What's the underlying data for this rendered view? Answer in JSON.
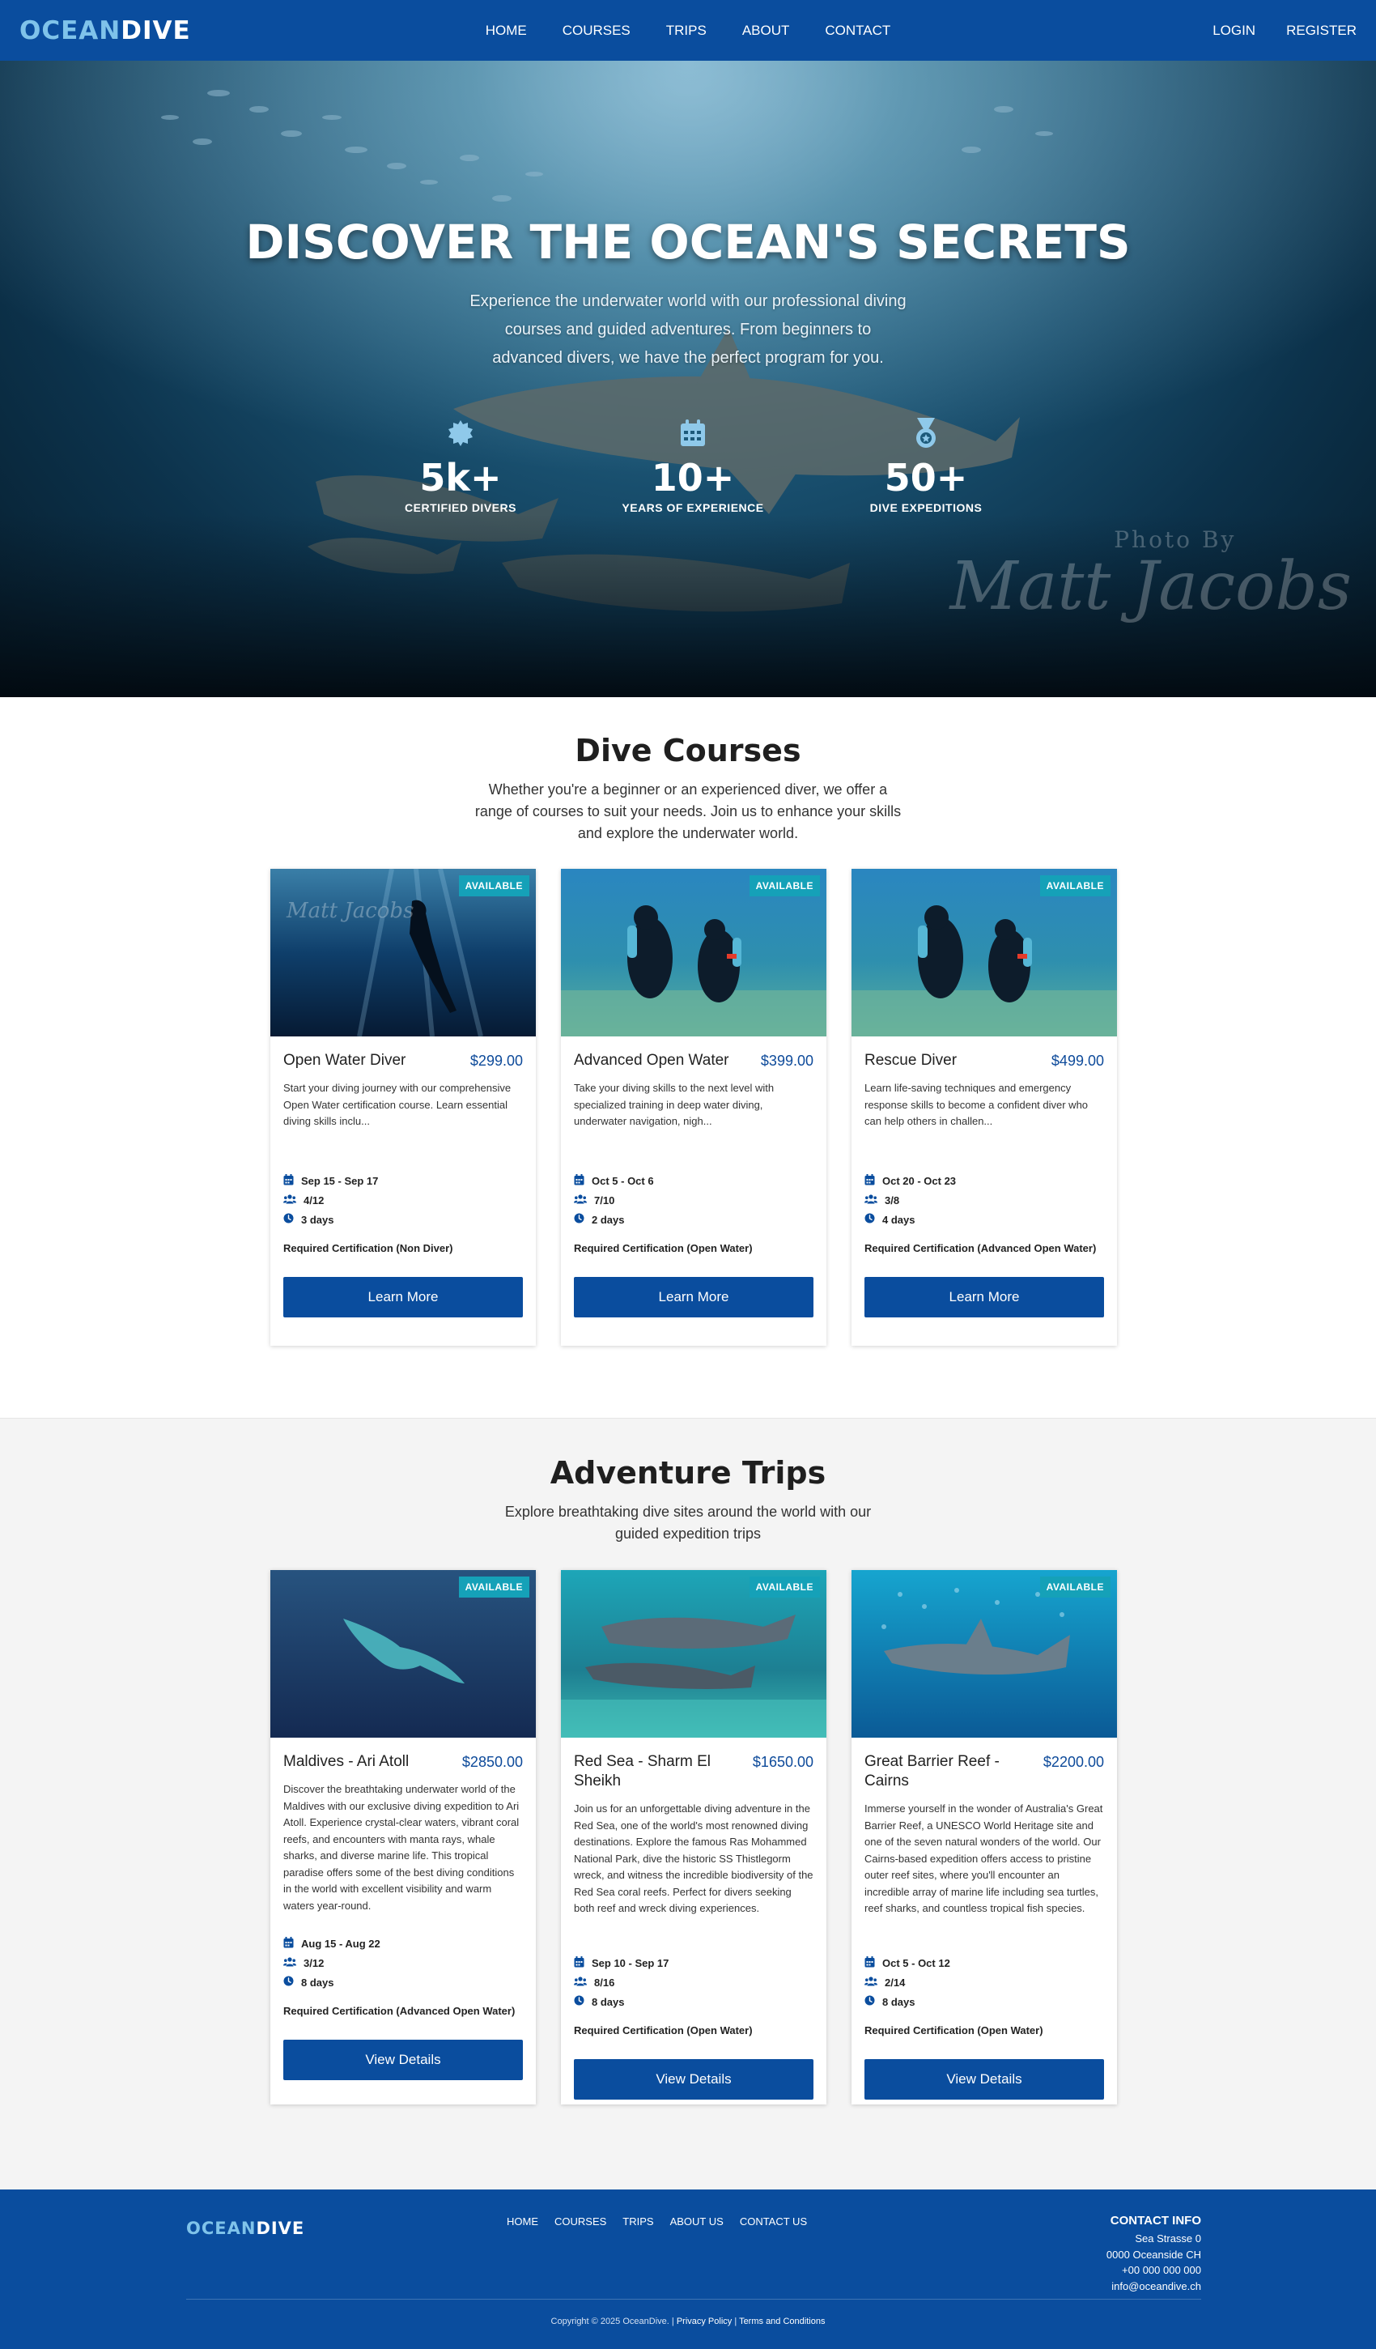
{
  "nav": {
    "logo_part1": "OCEAN",
    "logo_part2": "DIVE",
    "links": [
      "HOME",
      "COURSES",
      "TRIPS",
      "ABOUT",
      "CONTACT"
    ],
    "login": "LOGIN",
    "register": "REGISTER"
  },
  "hero": {
    "title": "DISCOVER THE OCEAN'S SECRETS",
    "subtitle": "Experience the underwater world with our professional diving courses and guided adventures. From beginners to advanced divers, we have the perfect program for you.",
    "stats": [
      {
        "value": "5k+",
        "label": "CERTIFIED DIVERS",
        "icon": "badge-icon"
      },
      {
        "value": "10+",
        "label": "YEARS OF EXPERIENCE",
        "icon": "calendar-icon"
      },
      {
        "value": "50+",
        "label": "DIVE EXPEDITIONS",
        "icon": "medal-icon"
      }
    ],
    "photo_credit_line1": "Photo By",
    "photo_credit_line2": "Matt Jacobs"
  },
  "courses": {
    "title": "Dive Courses",
    "subtitle": "Whether you're a beginner or an experienced diver, we offer a range of courses to suit your needs. Join us to enhance your skills and explore the underwater world.",
    "items": [
      {
        "badge": "AVAILABLE",
        "title": "Open Water Diver",
        "price": "$299.00",
        "desc": "Start your diving journey with our comprehensive Open Water certification course. Learn essential diving skills inclu...",
        "dates": "Sep 15 - Sep 17",
        "spots": "4/12",
        "duration": "3 days",
        "cert": "Required Certification (Non Diver)",
        "button": "Learn More"
      },
      {
        "badge": "AVAILABLE",
        "title": "Advanced Open Water",
        "price": "$399.00",
        "desc": "Take your diving skills to the next level with specialized training in deep water diving, underwater navigation, nigh...",
        "dates": "Oct 5 - Oct 6",
        "spots": "7/10",
        "duration": "2 days",
        "cert": "Required Certification (Open Water)",
        "button": "Learn More"
      },
      {
        "badge": "AVAILABLE",
        "title": "Rescue Diver",
        "price": "$499.00",
        "desc": "Learn life-saving techniques and emergency response skills to become a confident diver who can help others in challen...",
        "dates": "Oct 20 - Oct 23",
        "spots": "3/8",
        "duration": "4 days",
        "cert": "Required Certification (Advanced Open Water)",
        "button": "Learn More"
      }
    ]
  },
  "trips": {
    "title": "Adventure Trips",
    "subtitle": "Explore breathtaking dive sites around the world with our guided expedition trips",
    "items": [
      {
        "badge": "AVAILABLE",
        "title": "Maldives - Ari Atoll",
        "price": "$2850.00",
        "desc": "Discover the breathtaking underwater world of the Maldives with our exclusive diving expedition to Ari Atoll. Experience crystal-clear waters, vibrant coral reefs, and encounters with manta rays, whale sharks, and diverse marine life. This tropical paradise offers some of the best diving conditions in the world with excellent visibility and warm waters year-round.",
        "dates": "Aug 15 - Aug 22",
        "spots": "3/12",
        "duration": "8 days",
        "cert": "Required Certification (Advanced Open Water)",
        "button": "View Details"
      },
      {
        "badge": "AVAILABLE",
        "title": "Red Sea - Sharm El Sheikh",
        "price": "$1650.00",
        "desc": "Join us for an unforgettable diving adventure in the Red Sea, one of the world's most renowned diving destinations. Explore the famous Ras Mohammed National Park, dive the historic SS Thistlegorm wreck, and witness the incredible biodiversity of the Red Sea coral reefs. Perfect for divers seeking both reef and wreck diving experiences.",
        "dates": "Sep 10 - Sep 17",
        "spots": "8/16",
        "duration": "8 days",
        "cert": "Required Certification (Open Water)",
        "button": "View Details"
      },
      {
        "badge": "AVAILABLE",
        "title": "Great Barrier Reef - Cairns",
        "price": "$2200.00",
        "desc": "Immerse yourself in the wonder of Australia's Great Barrier Reef, a UNESCO World Heritage site and one of the seven natural wonders of the world. Our Cairns-based expedition offers access to pristine outer reef sites, where you'll encounter an incredible array of marine life including sea turtles, reef sharks, and countless tropical fish species.",
        "dates": "Oct 5 - Oct 12",
        "spots": "2/14",
        "duration": "8 days",
        "cert": "Required Certification (Open Water)",
        "button": "View Details"
      }
    ]
  },
  "footer": {
    "links": [
      "HOME",
      "COURSES",
      "TRIPS",
      "ABOUT US",
      "CONTACT US"
    ],
    "contact_title": "CONTACT INFO",
    "address1": "Sea Strasse 0",
    "address2": "0000 Oceanside CH",
    "phone": "+00 000 000 000",
    "email": "info@oceandive.ch",
    "copyright": "Copyright © 2025 OceanDive.",
    "privacy": "Privacy Policy",
    "separator": "|",
    "terms": "Terms and Conditions"
  },
  "colors": {
    "brand_blue": "#0a4d9e",
    "logo_light": "#7fc3ea",
    "badge_teal": "#15a1b8",
    "price_blue": "#0d4a9a"
  }
}
